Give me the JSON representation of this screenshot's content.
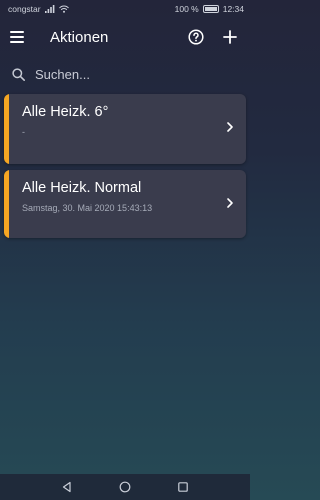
{
  "status_bar": {
    "carrier": "congstar",
    "battery_text": "100 %",
    "time": "12:34"
  },
  "app_bar": {
    "title": "Aktionen",
    "menu_icon": "hamburger-menu-icon",
    "help_icon": "help-circle-icon",
    "add_icon": "plus-icon"
  },
  "search": {
    "placeholder": "Suchen...",
    "value": ""
  },
  "actions": [
    {
      "name": "Alle Heizk. 6°",
      "subtitle": "-"
    },
    {
      "name": "Alle Heizk. Normal",
      "subtitle": "Samstag, 30. Mai 2020 15:43:13"
    }
  ],
  "colors": {
    "accent": "#f5a623",
    "card_bg": "#3a3c4d",
    "background_top": "#23253a",
    "background_bottom": "#264a55"
  }
}
